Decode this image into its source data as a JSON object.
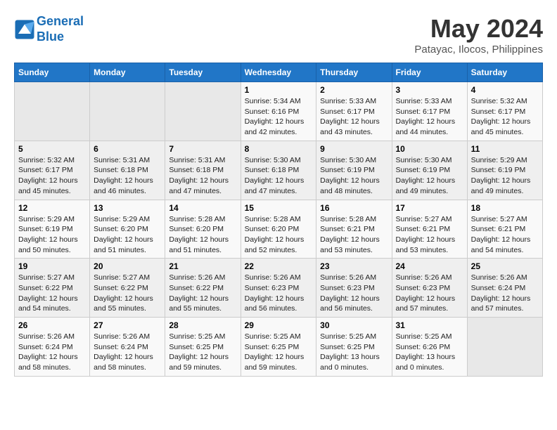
{
  "header": {
    "logo_line1": "General",
    "logo_line2": "Blue",
    "month": "May 2024",
    "location": "Patayac, Ilocos, Philippines"
  },
  "weekdays": [
    "Sunday",
    "Monday",
    "Tuesday",
    "Wednesday",
    "Thursday",
    "Friday",
    "Saturday"
  ],
  "weeks": [
    [
      {
        "day": "",
        "info": ""
      },
      {
        "day": "",
        "info": ""
      },
      {
        "day": "",
        "info": ""
      },
      {
        "day": "1",
        "info": "Sunrise: 5:34 AM\nSunset: 6:16 PM\nDaylight: 12 hours\nand 42 minutes."
      },
      {
        "day": "2",
        "info": "Sunrise: 5:33 AM\nSunset: 6:17 PM\nDaylight: 12 hours\nand 43 minutes."
      },
      {
        "day": "3",
        "info": "Sunrise: 5:33 AM\nSunset: 6:17 PM\nDaylight: 12 hours\nand 44 minutes."
      },
      {
        "day": "4",
        "info": "Sunrise: 5:32 AM\nSunset: 6:17 PM\nDaylight: 12 hours\nand 45 minutes."
      }
    ],
    [
      {
        "day": "5",
        "info": "Sunrise: 5:32 AM\nSunset: 6:17 PM\nDaylight: 12 hours\nand 45 minutes."
      },
      {
        "day": "6",
        "info": "Sunrise: 5:31 AM\nSunset: 6:18 PM\nDaylight: 12 hours\nand 46 minutes."
      },
      {
        "day": "7",
        "info": "Sunrise: 5:31 AM\nSunset: 6:18 PM\nDaylight: 12 hours\nand 47 minutes."
      },
      {
        "day": "8",
        "info": "Sunrise: 5:30 AM\nSunset: 6:18 PM\nDaylight: 12 hours\nand 47 minutes."
      },
      {
        "day": "9",
        "info": "Sunrise: 5:30 AM\nSunset: 6:19 PM\nDaylight: 12 hours\nand 48 minutes."
      },
      {
        "day": "10",
        "info": "Sunrise: 5:30 AM\nSunset: 6:19 PM\nDaylight: 12 hours\nand 49 minutes."
      },
      {
        "day": "11",
        "info": "Sunrise: 5:29 AM\nSunset: 6:19 PM\nDaylight: 12 hours\nand 49 minutes."
      }
    ],
    [
      {
        "day": "12",
        "info": "Sunrise: 5:29 AM\nSunset: 6:19 PM\nDaylight: 12 hours\nand 50 minutes."
      },
      {
        "day": "13",
        "info": "Sunrise: 5:29 AM\nSunset: 6:20 PM\nDaylight: 12 hours\nand 51 minutes."
      },
      {
        "day": "14",
        "info": "Sunrise: 5:28 AM\nSunset: 6:20 PM\nDaylight: 12 hours\nand 51 minutes."
      },
      {
        "day": "15",
        "info": "Sunrise: 5:28 AM\nSunset: 6:20 PM\nDaylight: 12 hours\nand 52 minutes."
      },
      {
        "day": "16",
        "info": "Sunrise: 5:28 AM\nSunset: 6:21 PM\nDaylight: 12 hours\nand 53 minutes."
      },
      {
        "day": "17",
        "info": "Sunrise: 5:27 AM\nSunset: 6:21 PM\nDaylight: 12 hours\nand 53 minutes."
      },
      {
        "day": "18",
        "info": "Sunrise: 5:27 AM\nSunset: 6:21 PM\nDaylight: 12 hours\nand 54 minutes."
      }
    ],
    [
      {
        "day": "19",
        "info": "Sunrise: 5:27 AM\nSunset: 6:22 PM\nDaylight: 12 hours\nand 54 minutes."
      },
      {
        "day": "20",
        "info": "Sunrise: 5:27 AM\nSunset: 6:22 PM\nDaylight: 12 hours\nand 55 minutes."
      },
      {
        "day": "21",
        "info": "Sunrise: 5:26 AM\nSunset: 6:22 PM\nDaylight: 12 hours\nand 55 minutes."
      },
      {
        "day": "22",
        "info": "Sunrise: 5:26 AM\nSunset: 6:23 PM\nDaylight: 12 hours\nand 56 minutes."
      },
      {
        "day": "23",
        "info": "Sunrise: 5:26 AM\nSunset: 6:23 PM\nDaylight: 12 hours\nand 56 minutes."
      },
      {
        "day": "24",
        "info": "Sunrise: 5:26 AM\nSunset: 6:23 PM\nDaylight: 12 hours\nand 57 minutes."
      },
      {
        "day": "25",
        "info": "Sunrise: 5:26 AM\nSunset: 6:24 PM\nDaylight: 12 hours\nand 57 minutes."
      }
    ],
    [
      {
        "day": "26",
        "info": "Sunrise: 5:26 AM\nSunset: 6:24 PM\nDaylight: 12 hours\nand 58 minutes."
      },
      {
        "day": "27",
        "info": "Sunrise: 5:26 AM\nSunset: 6:24 PM\nDaylight: 12 hours\nand 58 minutes."
      },
      {
        "day": "28",
        "info": "Sunrise: 5:25 AM\nSunset: 6:25 PM\nDaylight: 12 hours\nand 59 minutes."
      },
      {
        "day": "29",
        "info": "Sunrise: 5:25 AM\nSunset: 6:25 PM\nDaylight: 12 hours\nand 59 minutes."
      },
      {
        "day": "30",
        "info": "Sunrise: 5:25 AM\nSunset: 6:25 PM\nDaylight: 13 hours\nand 0 minutes."
      },
      {
        "day": "31",
        "info": "Sunrise: 5:25 AM\nSunset: 6:26 PM\nDaylight: 13 hours\nand 0 minutes."
      },
      {
        "day": "",
        "info": ""
      }
    ]
  ]
}
